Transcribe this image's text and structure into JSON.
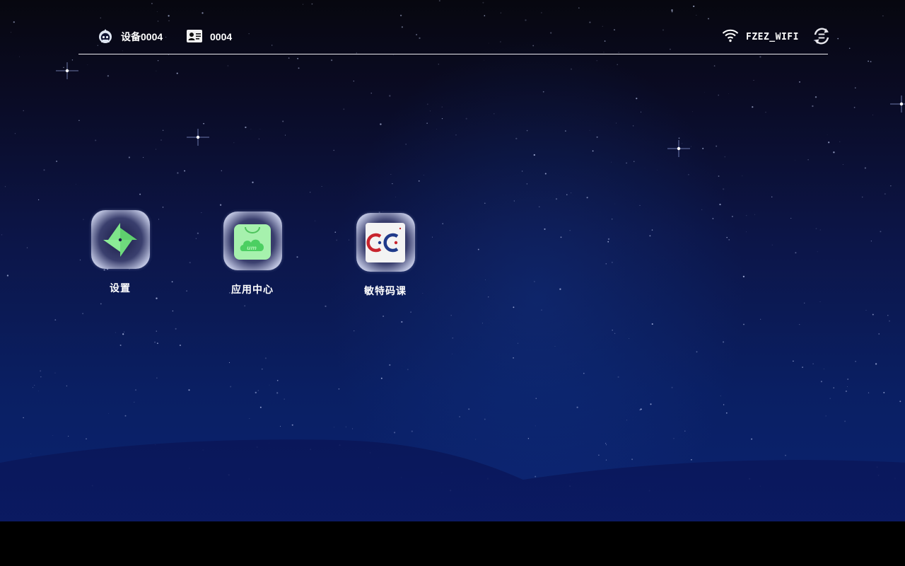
{
  "statusbar": {
    "device_name": "设备0004",
    "device_icon": "robot-icon",
    "card_number": "0004",
    "card_icon": "id-card-icon",
    "wifi_ssid": "FZEZ_WIFI",
    "wifi_icon": "wifi-icon",
    "sync_icon": "sync-icon"
  },
  "apps": [
    {
      "label": "设置",
      "icon": "settings-app-icon"
    },
    {
      "label": "应用中心",
      "icon": "app-center-icon"
    },
    {
      "label": "敏特码课",
      "icon": "mintcode-icon"
    }
  ],
  "colors": {
    "settings_green": "#6fe07a",
    "store_green": "#9ef0a6",
    "mint_red": "#c8242e",
    "mint_blue": "#1f3a8a"
  }
}
